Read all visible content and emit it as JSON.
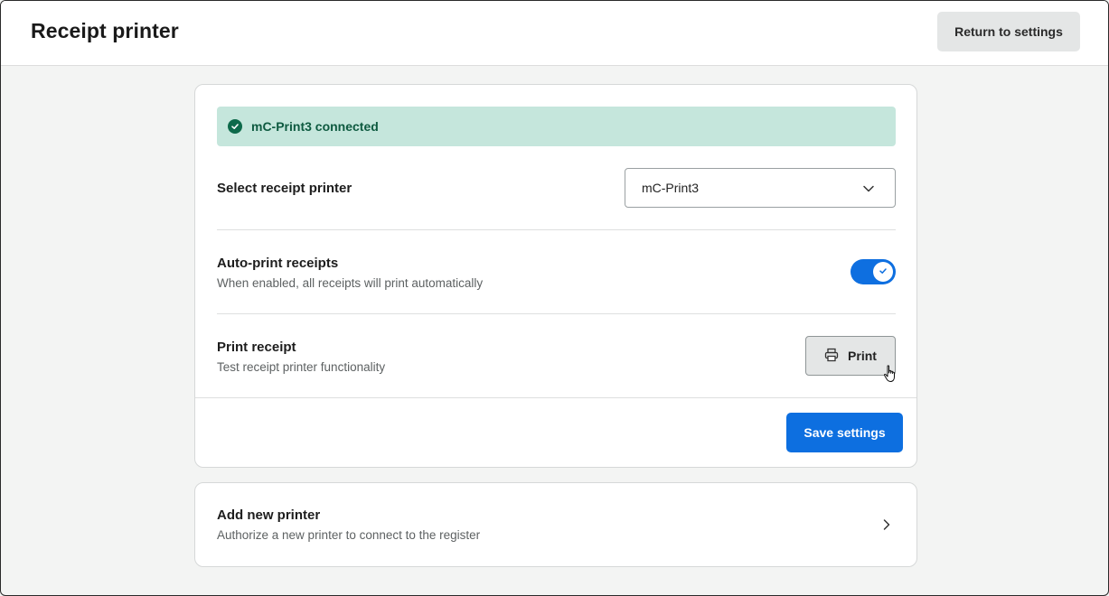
{
  "header": {
    "title": "Receipt printer",
    "return_label": "Return to settings"
  },
  "status": {
    "text": "mC-Print3 connected",
    "color": "#0e6a4b",
    "icon": "check-circle-icon"
  },
  "select_printer": {
    "label": "Select receipt printer",
    "value": "mC-Print3"
  },
  "auto_print": {
    "label": "Auto-print receipts",
    "description": "When enabled, all receipts will print automatically",
    "enabled": true
  },
  "print_receipt": {
    "label": "Print receipt",
    "description": "Test receipt printer functionality",
    "button_label": "Print"
  },
  "footer": {
    "save_label": "Save settings"
  },
  "add_printer": {
    "label": "Add new printer",
    "description": "Authorize a new printer to connect to the register"
  },
  "colors": {
    "accent": "#0d6fe0",
    "success_bg": "#c5e6dc"
  }
}
